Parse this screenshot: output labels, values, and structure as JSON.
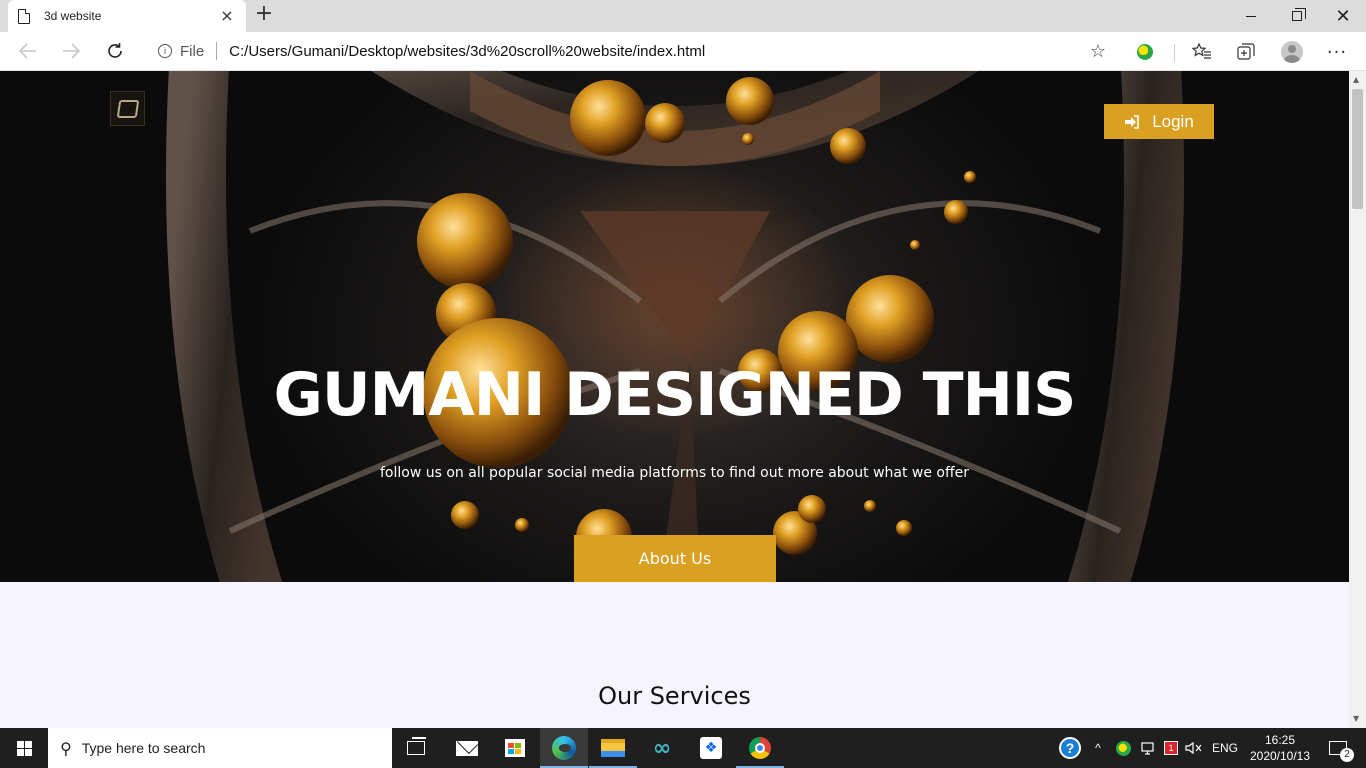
{
  "browser": {
    "tab_title": "3d website",
    "tab_close": "×",
    "new_tab": "+",
    "address": {
      "scheme_label": "File",
      "url": "C:/Users/Gumani/Desktop/websites/3d%20scroll%20website/index.html"
    },
    "window_close": "✕",
    "more_menu": "···"
  },
  "page": {
    "hero": {
      "login_label": "Login",
      "title": "GUMANI DESIGNED THIS",
      "subtitle": "follow us on all popular social media platforms to find out more about what we offer",
      "about_label": "About Us"
    },
    "services_title": "Our Services"
  },
  "taskbar": {
    "search_placeholder": "Type here to search",
    "tray": {
      "help": "?",
      "chevron": "^",
      "red_badge": "1",
      "language": "ENG",
      "time": "16:25",
      "date": "2020/10/13",
      "notifications_count": "2"
    }
  },
  "colors": {
    "accent": "#d9a021",
    "page_background": "#f6f4fe",
    "taskbar": "#1f1f1f"
  }
}
